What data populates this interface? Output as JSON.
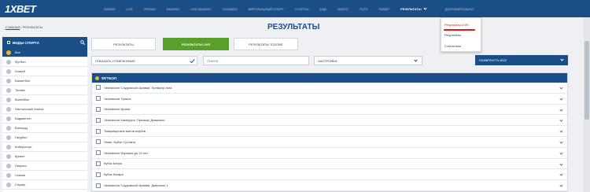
{
  "header": {
    "logo": "1XBET",
    "nav_items": [
      "ЛИНИЯ",
      "LIVE",
      "ПРОМО",
      "КАЗИНО",
      "LIVE-КАЗИНО",
      "1XGAMES",
      "ВИРТУАЛЬНЫЙ СПОРТ",
      "TV-ИГРЫ",
      "ЕЩЁ",
      "БИНГО",
      "ТОТО",
      "ПОКЕР"
    ],
    "results_label": "РЕЗУЛЬТАТЫ",
    "after_label": "ДОПОЛНИТЕЛЬНО"
  },
  "results_dropdown": {
    "items": [
      "Результаты LIVE",
      "Результаты",
      "Статистика"
    ]
  },
  "breadcrumb": {
    "home": "ГЛАВНАЯ",
    "sep": "/",
    "current": "РЕЗУЛЬТАТЫ"
  },
  "page_title": "РЕЗУЛЬТАТЫ",
  "sidebar": {
    "title": "ВИДЫ СПОРТА",
    "items": [
      "Все",
      "Футбол",
      "Хоккей",
      "Баскетбол",
      "Теннис",
      "Волейбол",
      "Настольный теннис",
      "Бадминтон",
      "Бильярд",
      "Гандбол",
      "Киберспорт",
      "Крикет",
      "Лакросс",
      "Скачки",
      "Снукер"
    ]
  },
  "tabs": [
    "РЕЗУЛЬТАТЫ",
    "РЕЗУЛЬТАТЫ LIVE",
    "РЕЗУЛЬТАТЫ TOZONE"
  ],
  "filters": {
    "show_marked": "ПОКАЗАТЬ ОТМЕЧЕННЫЕ",
    "search_placeholder": "ПОИСК",
    "settings": "НАСТРОЙКИ",
    "expand_all": "РАЗВЕРНУТЬ ВСЕ"
  },
  "results": {
    "sport": "ФУТБОЛ",
    "leagues": [
      "Чемпионат Саудовской Аравии. Премьер лига",
      "Чемпионат Туниса",
      "Чемпионат Ирана",
      "Чемпионат Камеруна. Премьер Дивизион",
      "Товарищеские матчи клубов",
      "Оман. Кубок Султана",
      "Чемпионат Израиля до 19 лет",
      "Кубок Кипра",
      "Кубок Катара",
      "Чемпионат Саудовской Аравии. Дивизион 1"
    ]
  },
  "colors": {
    "brand_blue": "#1a4e86",
    "active_green": "#5a9e2b",
    "highlight_red": "#e01a1a",
    "accent_yellow": "#f3b21d"
  }
}
